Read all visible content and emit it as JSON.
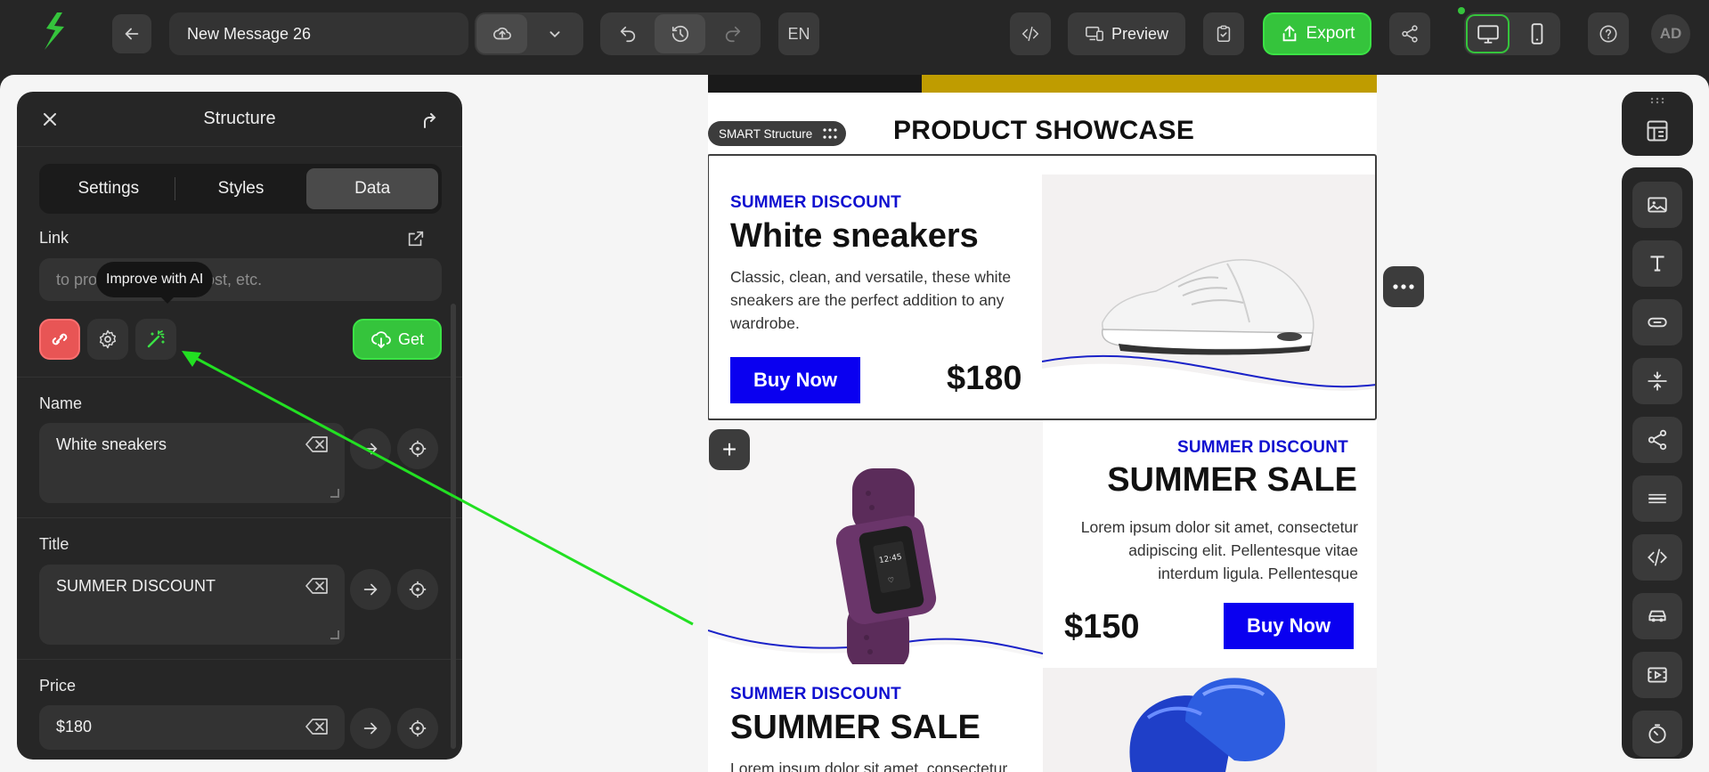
{
  "header": {
    "message_title": "New Message 26",
    "language": "EN",
    "preview_label": "Preview",
    "export_label": "Export",
    "avatar_initials": "AD"
  },
  "panel": {
    "title": "Structure",
    "tabs": [
      {
        "label": "Settings",
        "active": false
      },
      {
        "label": "Styles",
        "active": false
      },
      {
        "label": "Data",
        "active": true
      }
    ],
    "link": {
      "label": "Link",
      "placeholder": "to product, post, etc.",
      "visible_start": "to pro",
      "visible_end": "post, etc.",
      "tooltip": "Improve with AI",
      "get_label": "Get"
    },
    "name": {
      "label": "Name",
      "value": "White sneakers"
    },
    "title_field": {
      "label": "Title",
      "value": "SUMMER DISCOUNT"
    },
    "price": {
      "label": "Price",
      "value": "$180"
    }
  },
  "email": {
    "section_title": "PRODUCT SHOWCASE",
    "smart_chip": "SMART Structure",
    "cards": [
      {
        "discount": "SUMMER DISCOUNT",
        "name": "White sneakers",
        "description": "Classic, clean, and versatile, these white sneakers are the perfect addition to any wardrobe.",
        "desc_lines": [
          "Classic, clean, and versatile, these white",
          "sneakers are the perfect addition to any",
          "wardrobe."
        ],
        "buy_label": "Buy Now",
        "price": "$180",
        "image": "white-sneaker"
      },
      {
        "discount": "SUMMER DISCOUNT",
        "name": "SUMMER SALE",
        "desc_lines": [
          "Lorem ipsum dolor sit amet, consectetur",
          "adipiscing elit. Pellentesque vitae",
          "interdum ligula. Pellentesque"
        ],
        "buy_label": "Buy Now",
        "price": "$150",
        "image": "fitness-tracker"
      },
      {
        "discount": "SUMMER DISCOUNT",
        "name": "SUMMER SALE",
        "desc_lines": [
          "Lorem ipsum dolor sit amet, consectetur"
        ],
        "image": "boxing-gloves"
      }
    ]
  },
  "colors": {
    "accent_green": "#35c43c",
    "link_blue": "#0a00f0",
    "discount_blue": "#1010d0",
    "unlink_red": "#e85555",
    "panel_bg": "#262626"
  },
  "icons": {
    "right_toolbar": [
      "layout-icon",
      "image-icon",
      "text-icon",
      "button-icon",
      "spacer-icon",
      "social-icon",
      "divider-icon",
      "html-icon",
      "menu-icon",
      "video-icon",
      "timer-icon"
    ]
  }
}
